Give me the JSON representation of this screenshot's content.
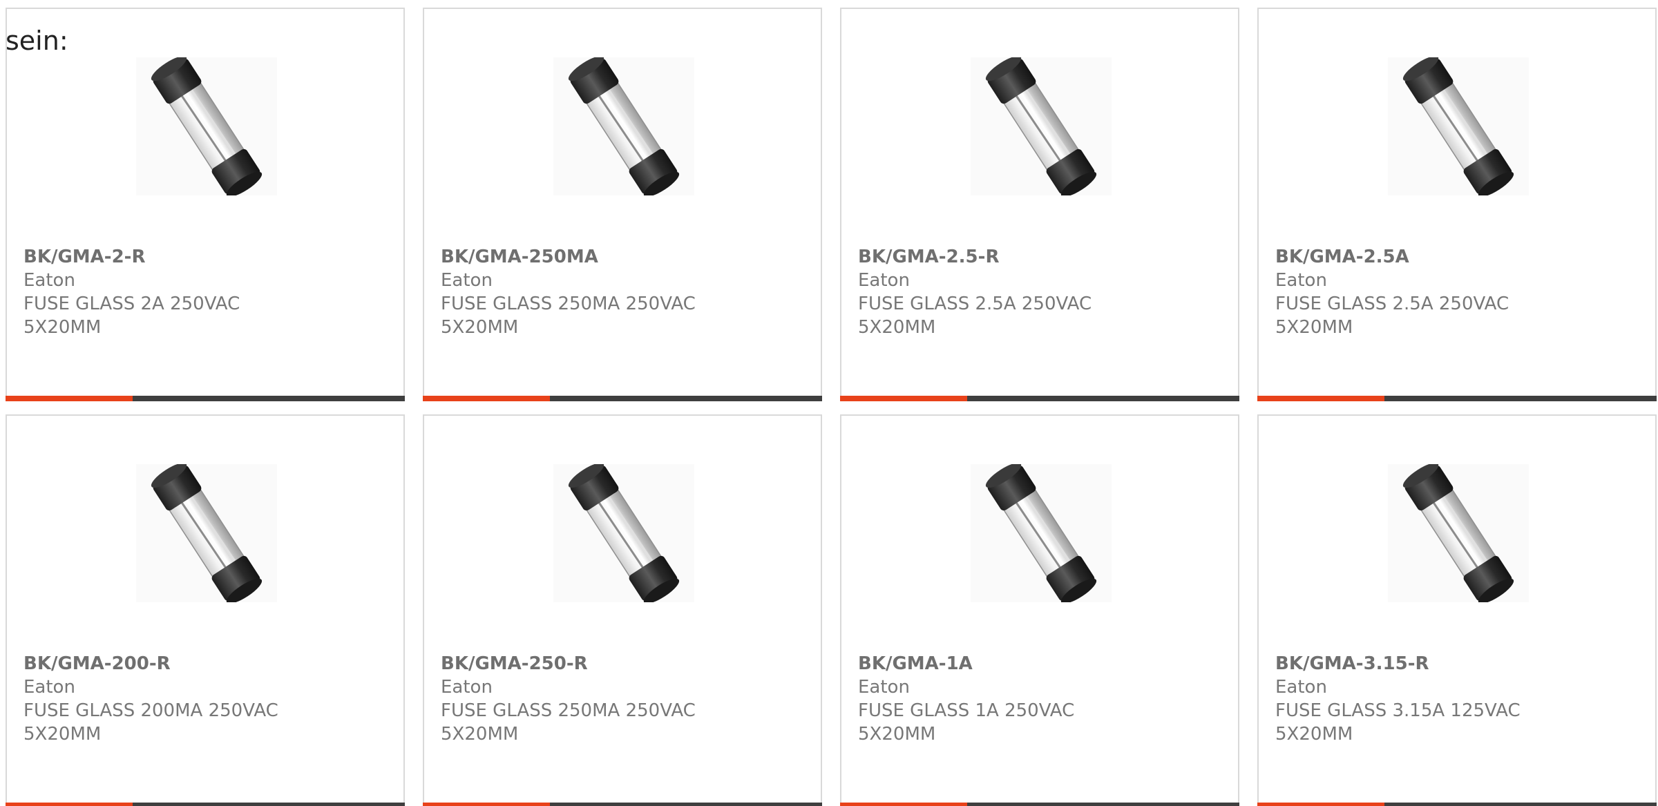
{
  "intro_text": "sein:",
  "colors": {
    "accent": "#e8421a",
    "bar": "#3f3f3f",
    "text": "#777777",
    "border": "#d9d9d9"
  },
  "products": [
    {
      "part": "BK/GMA-2-R",
      "manufacturer": "Eaton",
      "description": "FUSE GLASS 2A 250VAC 5X20MM",
      "image_icon": "glass-fuse-icon"
    },
    {
      "part": "BK/GMA-250MA",
      "manufacturer": "Eaton",
      "description": "FUSE GLASS 250MA 250VAC 5X20MM",
      "image_icon": "glass-fuse-icon"
    },
    {
      "part": "BK/GMA-2.5-R",
      "manufacturer": "Eaton",
      "description": "FUSE GLASS 2.5A 250VAC 5X20MM",
      "image_icon": "glass-fuse-icon"
    },
    {
      "part": "BK/GMA-2.5A",
      "manufacturer": "Eaton",
      "description": "FUSE GLASS 2.5A 250VAC 5X20MM",
      "image_icon": "glass-fuse-icon"
    },
    {
      "part": "BK/GMA-200-R",
      "manufacturer": "Eaton",
      "description": "FUSE GLASS 200MA 250VAC 5X20MM",
      "image_icon": "glass-fuse-icon"
    },
    {
      "part": "BK/GMA-250-R",
      "manufacturer": "Eaton",
      "description": "FUSE GLASS 250MA 250VAC 5X20MM",
      "image_icon": "glass-fuse-icon"
    },
    {
      "part": "BK/GMA-1A",
      "manufacturer": "Eaton",
      "description": "FUSE GLASS 1A 250VAC 5X20MM",
      "image_icon": "glass-fuse-icon"
    },
    {
      "part": "BK/GMA-3.15-R",
      "manufacturer": "Eaton",
      "description": "FUSE GLASS 3.15A 125VAC 5X20MM",
      "image_icon": "glass-fuse-icon"
    }
  ]
}
